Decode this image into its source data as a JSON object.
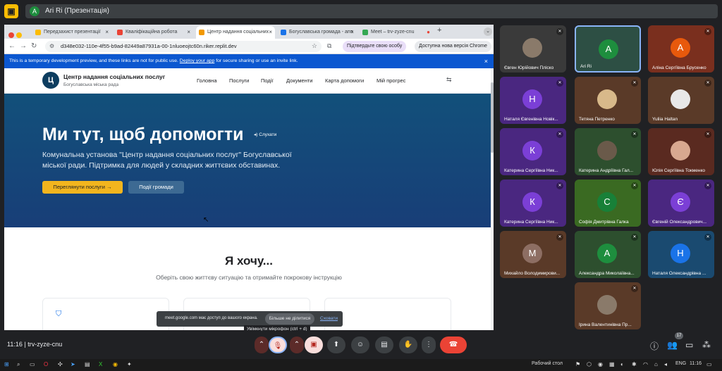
{
  "meet": {
    "logo": "meet-logo",
    "presenter": {
      "avatar": "A",
      "label": "Ari Ri (Презентація)"
    },
    "time_code": "11:16  |  trv-zyze-cnu",
    "participants_count": "17"
  },
  "browser": {
    "tabs": [
      {
        "label": "Передзахист презентації"
      },
      {
        "label": "Кваліфікаційна робота"
      },
      {
        "label": "Центр надання соціальних",
        "active": true
      },
      {
        "label": "Богуславська громада - апп"
      },
      {
        "label": "Meet – trv-zyze-cnu"
      }
    ],
    "url": "d348e032-110e-4f55-b9ad-82449a87931a-00-1nluoeojtc60n.riker.replit.dev",
    "verify_label": "Підтвердьте свою особу",
    "update_label": "Доступна нова версія Chrome"
  },
  "banner": {
    "text_before": "This is a temporary development preview, and these links are not for public use.",
    "link": "Deploy your app",
    "text_after": "for secure sharing or use an invite link."
  },
  "site": {
    "logo_letter": "Ц",
    "brand_title": "Центр надання соціальних послуг",
    "brand_sub": "Богуславська міська рада",
    "menu": [
      "Головна",
      "Послуги",
      "Події",
      "Документи",
      "Карта допомоги",
      "Мій прогрес"
    ],
    "hero": {
      "title": "Ми тут, щоб допомогти",
      "listen": "Слухати",
      "description": "Комунальна установа \"Центр надання соціальних послуг\" Богуславської міської ради. Підтримка для людей у складних життєвих обставинах.",
      "primary_button": "Переглянути послуги",
      "secondary_button": "Події громади"
    },
    "want": {
      "title": "Я хочу...",
      "subtitle": "Оберіть свою життєву ситуацію та отримайте покрокову інструкцію"
    }
  },
  "share_notice": {
    "text": "meet.google.com має доступ до вашого екрана.",
    "stop": "Більше не ділитися",
    "hide": "Сховати"
  },
  "tooltip": "Увімкнути мікрофон (ctrl + d)",
  "participants": [
    {
      "name": "Євген Юрійович Пліско",
      "letter": "",
      "color": "#8a7a6a"
    },
    {
      "name": "Ari Ri",
      "letter": "A",
      "color": "#1e8e3e"
    },
    {
      "name": "Аліна Сергіївна Брусенко",
      "letter": "А",
      "color": "#e8590c"
    },
    {
      "name": "Наталя Євгенівна Новік...",
      "letter": "Н",
      "color": "#7b3fd6"
    },
    {
      "name": "Тетяна Петренко",
      "letter": "",
      "color": "#d8b98a"
    },
    {
      "name": "Yuliia Haltan",
      "letter": "",
      "color": "#e8e8e8"
    },
    {
      "name": "Катерина Сергіївна Ник...",
      "letter": "К",
      "color": "#7b3fd6"
    },
    {
      "name": "Катерина Андріївна Гал...",
      "letter": "",
      "color": "#6a5a4a"
    },
    {
      "name": "Юлія Сергіївна Токменко",
      "letter": "",
      "color": "#d8a890"
    },
    {
      "name": "Катерина Сергіївна Ник...",
      "letter": "К",
      "color": "#7b3fd6"
    },
    {
      "name": "Софія Дмитрівна Галка",
      "letter": "С",
      "color": "#188038"
    },
    {
      "name": "Євгеній Олександрович...",
      "letter": "Є",
      "color": "#7b3fd6"
    },
    {
      "name": "Михайло Володимирови...",
      "letter": "М",
      "color": "#8d6e63"
    },
    {
      "name": "Александра Миколаївна...",
      "letter": "А",
      "color": "#1e8e3e"
    },
    {
      "name": "Наталя Олександрівна ...",
      "letter": "Н",
      "color": "#1a73e8"
    },
    {
      "name": "Ірина Валентинівна Пр...",
      "letter": "",
      "color": "#8a7a6a"
    }
  ],
  "taskbar": {
    "desktop": "Рабочий стол",
    "lang": "ENG",
    "time": "11:16"
  },
  "colors": {
    "meet_bg": "#202124",
    "hero_start": "#12507a",
    "hero_end": "#183e78",
    "primary": "#f2b51e",
    "end_call": "#ea4335",
    "mic_off": "#f9dedc"
  }
}
